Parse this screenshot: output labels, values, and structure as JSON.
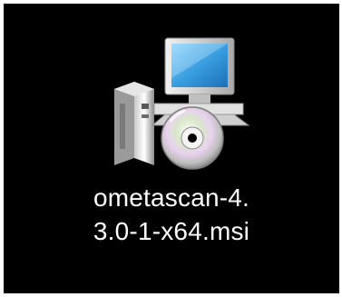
{
  "desktop_icon": {
    "icon": "msi-installer-icon",
    "label_line_1": "ometascan-4.",
    "label_line_2": "3.0-1-x64.msi"
  },
  "colors": {
    "background": "#000000",
    "label_text": "#ffffff",
    "monitor_screen": "#3a9fe0",
    "monitor_frame": "#d8d8d8",
    "disc": "#c8c8c8"
  }
}
